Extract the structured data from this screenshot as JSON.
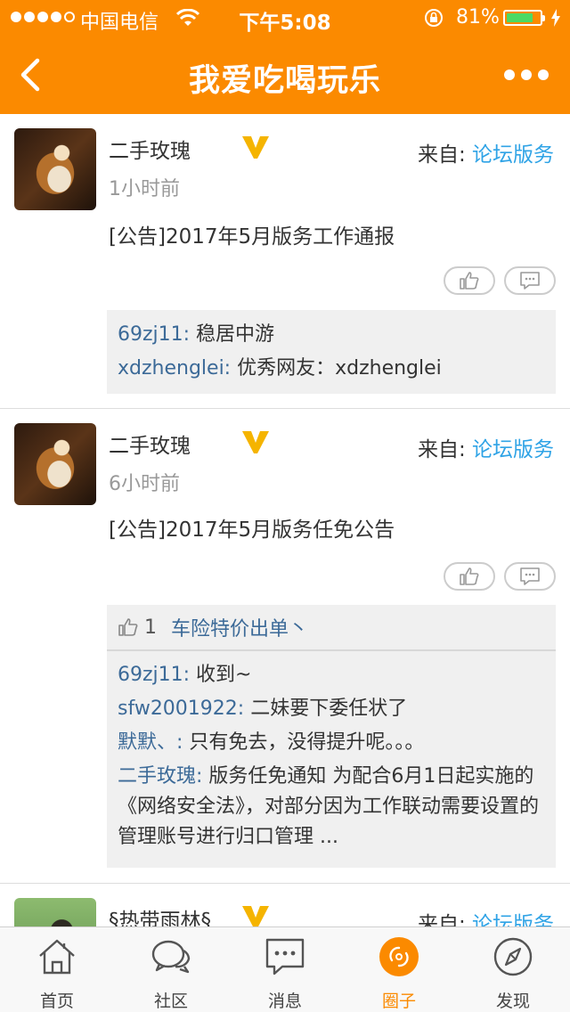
{
  "status_bar": {
    "carrier": "中国电信",
    "time": "下午5:08",
    "battery_percent": "81%",
    "battery_level": 0.81,
    "signal_bars": 4
  },
  "nav": {
    "title": "我爱吃喝玩乐",
    "back_icon": "back-chevron-icon",
    "more_icon": "more-dots-icon"
  },
  "colors": {
    "accent": "#fb8a00",
    "link": "#2fa3e6",
    "username": "#3c6a98",
    "vip": "#f5b400"
  },
  "posts": [
    {
      "author": "二手玫瑰",
      "time": "1小时前",
      "source_prefix": "来自: ",
      "source_link": "论坛版务",
      "title": "[公告]2017年5月版务工作通报",
      "comments": [
        {
          "user": "69zj11:",
          "text": " 稳居中游"
        },
        {
          "user": "xdzhenglei:",
          "text": " 优秀网友：xdzhenglei"
        }
      ]
    },
    {
      "author": "二手玫瑰",
      "time": "6小时前",
      "source_prefix": "来自: ",
      "source_link": "论坛版务",
      "title": "[公告]2017年5月版务任免公告",
      "likes": {
        "count": "1",
        "users": "车险特价出单丶"
      },
      "comments": [
        {
          "user": "69zj11:",
          "text": " 收到~"
        },
        {
          "user": "sfw2001922:",
          "text": " 二妹要下委任状了"
        },
        {
          "user": "默默、:",
          "text": " 只有免去，没得提升呢。。。"
        },
        {
          "user": "二手玫瑰:",
          "text": " 版务任免通知 为配合6月1日起实施的《网络安全法》，对部分因为工作联动需要设置的管理账号进行归口管理 ..."
        }
      ]
    },
    {
      "author": "§热带雨林§",
      "source_prefix": "来自: ",
      "source_link": "论坛版务"
    }
  ],
  "tabs": [
    {
      "label": "首页",
      "icon": "home-icon"
    },
    {
      "label": "社区",
      "icon": "chat-bubbles-icon"
    },
    {
      "label": "消息",
      "icon": "message-icon"
    },
    {
      "label": "圈子",
      "icon": "circle-icon",
      "active": true
    },
    {
      "label": "发现",
      "icon": "compass-icon"
    }
  ]
}
